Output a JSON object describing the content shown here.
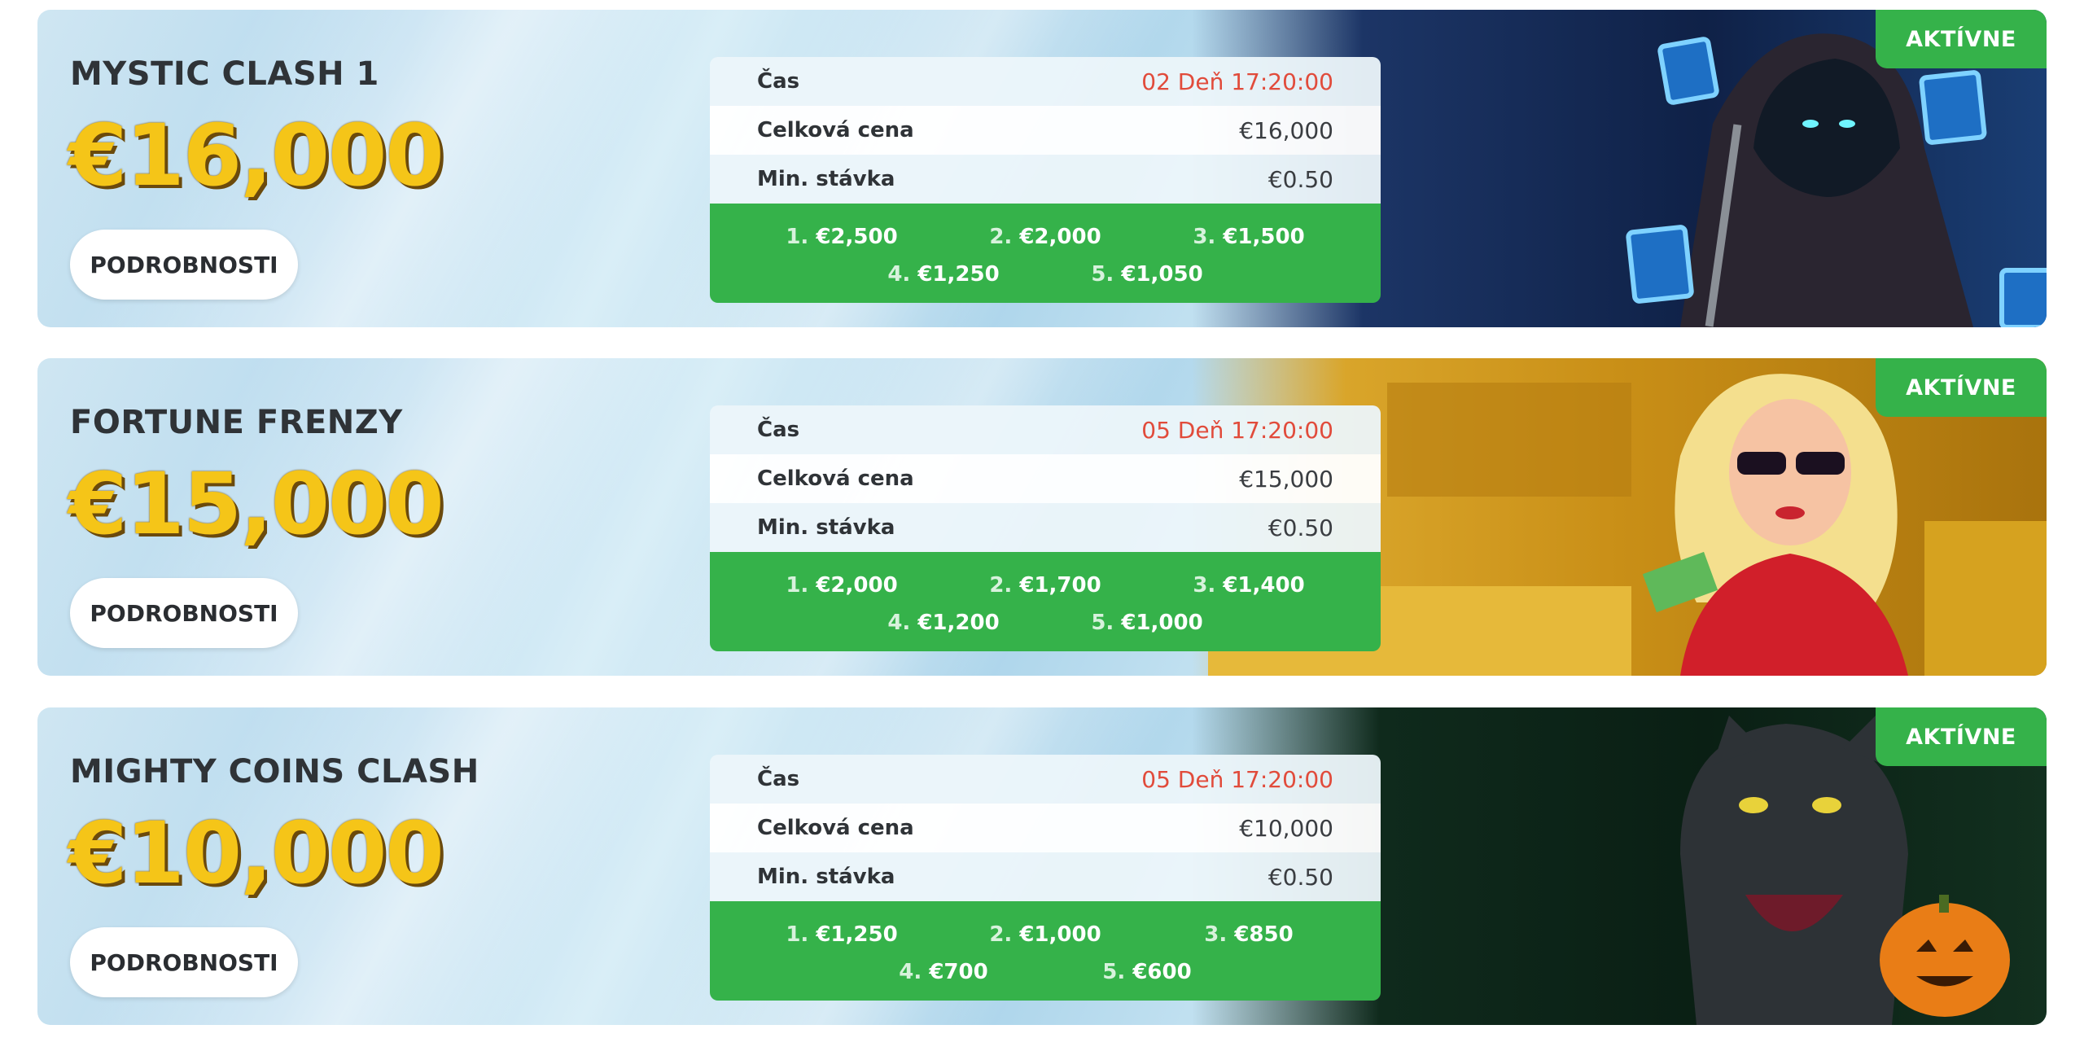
{
  "cards": [
    {
      "title": "MYSTIC CLASH 1",
      "amount": "€16,000",
      "button": "PODROBNOSTI",
      "status": "AKTÍVNE",
      "rows": {
        "time_label": "Čas",
        "time_value": "02 Deň  17:20:00",
        "total_label": "Celková cena",
        "total_value": "€16,000",
        "minbet_label": "Min. stávka",
        "minbet_value": "€0.50"
      },
      "prizes": [
        {
          "n": "1.",
          "v": "€2,500"
        },
        {
          "n": "2.",
          "v": "€2,000"
        },
        {
          "n": "3.",
          "v": "€1,500"
        },
        {
          "n": "4.",
          "v": "€1,250"
        },
        {
          "n": "5.",
          "v": "€1,050"
        }
      ],
      "art_icon": "hooded-reaper-icon"
    },
    {
      "title": "FORTUNE FRENZY",
      "amount": "€15,000",
      "button": "PODROBNOSTI",
      "status": "AKTÍVNE",
      "rows": {
        "time_label": "Čas",
        "time_value": "05 Deň  17:20:00",
        "total_label": "Celková cena",
        "total_value": "€15,000",
        "minbet_label": "Min. stávka",
        "minbet_value": "€0.50"
      },
      "prizes": [
        {
          "n": "1.",
          "v": "€2,000"
        },
        {
          "n": "2.",
          "v": "€1,700"
        },
        {
          "n": "3.",
          "v": "€1,400"
        },
        {
          "n": "4.",
          "v": "€1,200"
        },
        {
          "n": "5.",
          "v": "€1,000"
        }
      ],
      "art_icon": "blonde-woman-icon"
    },
    {
      "title": "MIGHTY COINS CLASH",
      "amount": "€10,000",
      "button": "PODROBNOSTI",
      "status": "AKTÍVNE",
      "rows": {
        "time_label": "Čas",
        "time_value": "05 Deň  17:20:00",
        "total_label": "Celková cena",
        "total_value": "€10,000",
        "minbet_label": "Min. stávka",
        "minbet_value": "€0.50"
      },
      "prizes": [
        {
          "n": "1.",
          "v": "€1,250"
        },
        {
          "n": "2.",
          "v": "€1,000"
        },
        {
          "n": "3.",
          "v": "€850"
        },
        {
          "n": "4.",
          "v": "€700"
        },
        {
          "n": "5.",
          "v": "€600"
        }
      ],
      "art_icon": "panther-icon"
    }
  ],
  "colors": {
    "accent_green": "#35b24a",
    "amount_yellow": "#f5c518",
    "time_red": "#e14b3b"
  }
}
